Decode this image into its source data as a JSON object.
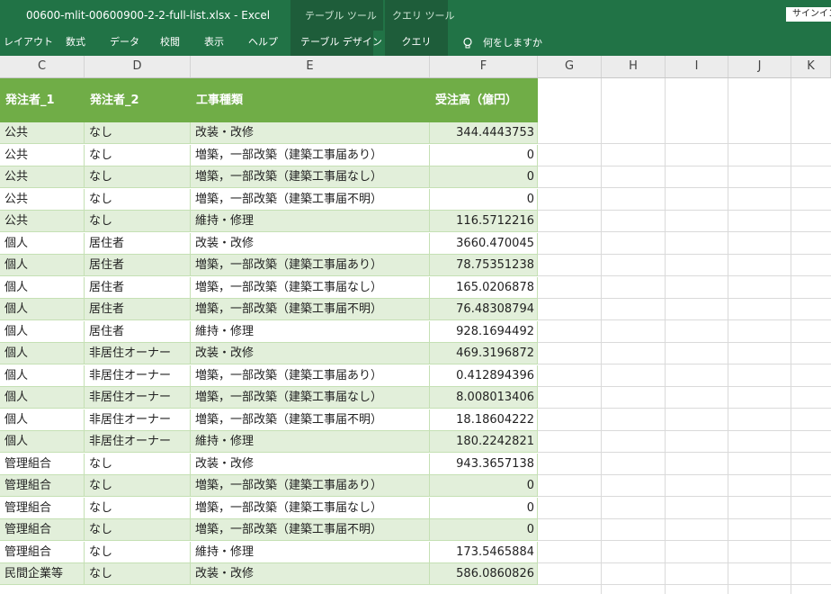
{
  "window": {
    "title": "00600-mlit-00600900-2-2-full-list.xlsx  -  Excel",
    "context_table_label": "テーブル ツール",
    "context_query_label": "クエリ ツール",
    "signin": "サインイン"
  },
  "ribbon": {
    "tabs": [
      "レイアウト",
      "数式",
      "データ",
      "校閲",
      "表示",
      "ヘルプ"
    ],
    "table_design_tab": "テーブル デザイン",
    "query_tab": "クエリ",
    "tell_me": "何をしますか"
  },
  "columns": [
    "C",
    "D",
    "E",
    "F",
    "G",
    "H",
    "I",
    "J",
    "K"
  ],
  "table": {
    "headers": [
      "発注者_1",
      "発注者_2",
      "工事種類",
      "受注高（億円）"
    ],
    "rows": [
      [
        "公共",
        "なし",
        "改装・改修",
        "344.4443753"
      ],
      [
        "公共",
        "なし",
        "増築，一部改築（建築工事届あり）",
        "0"
      ],
      [
        "公共",
        "なし",
        "増築，一部改築（建築工事届なし）",
        "0"
      ],
      [
        "公共",
        "なし",
        "増築，一部改築（建築工事届不明）",
        "0"
      ],
      [
        "公共",
        "なし",
        "維持・修理",
        "116.5712216"
      ],
      [
        "個人",
        "居住者",
        "改装・改修",
        "3660.470045"
      ],
      [
        "個人",
        "居住者",
        "増築，一部改築（建築工事届あり）",
        "78.75351238"
      ],
      [
        "個人",
        "居住者",
        "増築，一部改築（建築工事届なし）",
        "165.0206878"
      ],
      [
        "個人",
        "居住者",
        "増築，一部改築（建築工事届不明）",
        "76.48308794"
      ],
      [
        "個人",
        "居住者",
        "維持・修理",
        "928.1694492"
      ],
      [
        "個人",
        "非居住オーナー",
        "改装・改修",
        "469.3196872"
      ],
      [
        "個人",
        "非居住オーナー",
        "増築，一部改築（建築工事届あり）",
        "0.412894396"
      ],
      [
        "個人",
        "非居住オーナー",
        "増築，一部改築（建築工事届なし）",
        "8.008013406"
      ],
      [
        "個人",
        "非居住オーナー",
        "増築，一部改築（建築工事届不明）",
        "18.18604222"
      ],
      [
        "個人",
        "非居住オーナー",
        "維持・修理",
        "180.2242821"
      ],
      [
        "管理組合",
        "なし",
        "改装・改修",
        "943.3657138"
      ],
      [
        "管理組合",
        "なし",
        "増築，一部改築（建築工事届あり）",
        "0"
      ],
      [
        "管理組合",
        "なし",
        "増築，一部改築（建築工事届なし）",
        "0"
      ],
      [
        "管理組合",
        "なし",
        "増築，一部改築（建築工事届不明）",
        "0"
      ],
      [
        "管理組合",
        "なし",
        "維持・修理",
        "173.5465884"
      ],
      [
        "民間企業等",
        "なし",
        "改装・改修",
        "586.0860826"
      ]
    ]
  },
  "colors": {
    "excel_green": "#217346",
    "table_header": "#70ad47",
    "band": "#e2efda"
  }
}
